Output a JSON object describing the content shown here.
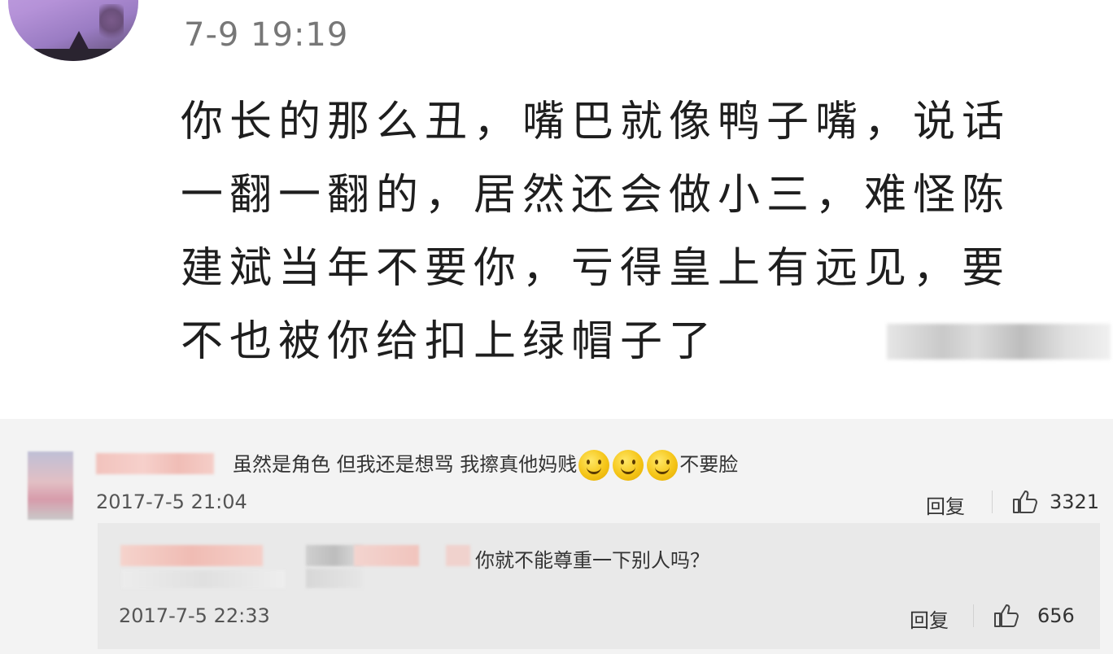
{
  "post": {
    "time": "7-9 19:19",
    "text": "你长的那么丑，嘴巴就像鸭子嘴，说话一翻一翻的，居然还会做小三，难怪陈建斌当年不要你，亏得皇上有远见，要不也被你给扣上绿帽子了"
  },
  "comments": [
    {
      "text_before": "虽然是角色 但我还是想骂 我擦真他妈贱",
      "emoji": "smiley-icon",
      "emoji_count": 3,
      "text_after": "不要脸",
      "time": "2017-7-5 21:04",
      "reply_label": "回复",
      "likes": "3321"
    }
  ],
  "reply": {
    "text": "你就不能尊重一下别人吗？",
    "time": "2017-7-5 22:33",
    "reply_label": "回复",
    "likes": "656"
  },
  "colors": {
    "comment_bg": "#f3f3f3",
    "reply_bg": "#e9e9e9",
    "emoji": "#f5c518"
  }
}
